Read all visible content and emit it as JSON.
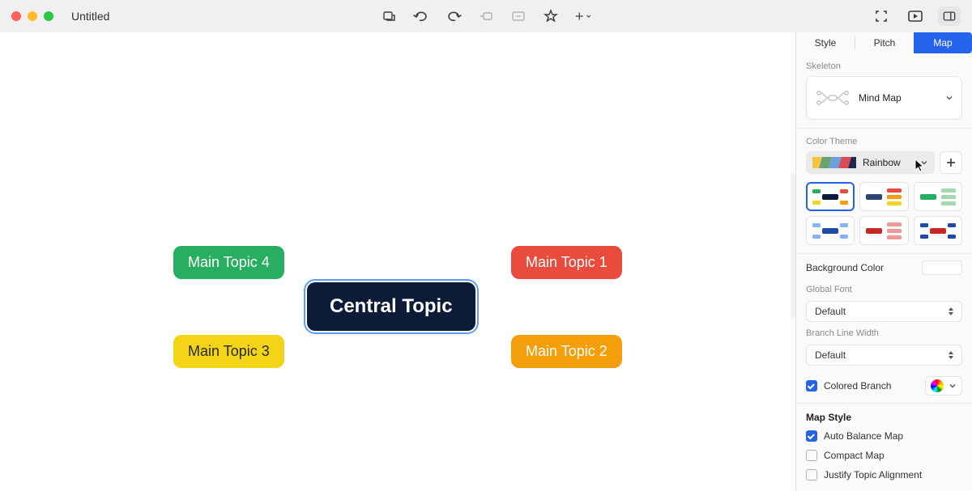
{
  "titlebar": {
    "title": "Untitled"
  },
  "canvas": {
    "central": "Central Topic",
    "topic1": "Main Topic 1",
    "topic2": "Main Topic 2",
    "topic3": "Main Topic 3",
    "topic4": "Main Topic 4"
  },
  "sidebar": {
    "tabs": {
      "style": "Style",
      "pitch": "Pitch",
      "map": "Map"
    },
    "skeleton": {
      "label": "Skeleton",
      "value": "Mind Map"
    },
    "colorTheme": {
      "label": "Color Theme",
      "value": "Rainbow"
    },
    "backgroundColor": {
      "label": "Background Color"
    },
    "globalFont": {
      "label": "Global Font",
      "value": "Default"
    },
    "branchLineWidth": {
      "label": "Branch Line Width",
      "value": "Default"
    },
    "coloredBranch": {
      "label": "Colored Branch"
    },
    "mapStyle": {
      "heading": "Map Style",
      "autoBalance": "Auto Balance Map",
      "compact": "Compact Map",
      "justify": "Justify Topic Alignment"
    }
  }
}
